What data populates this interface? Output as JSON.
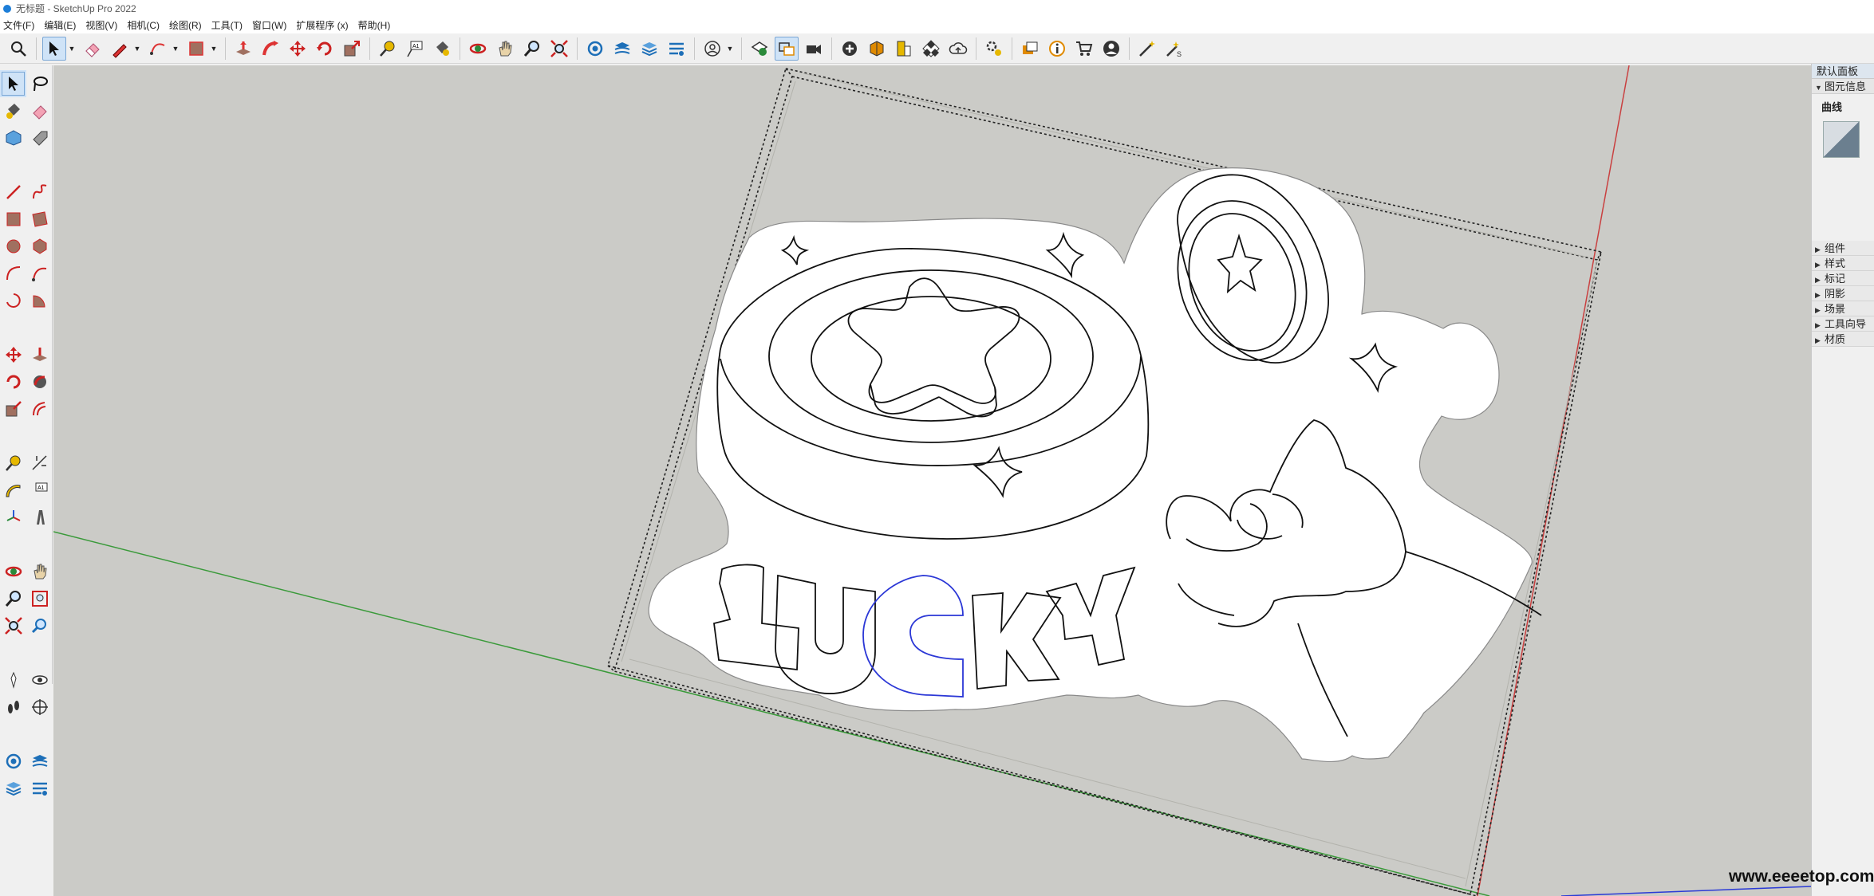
{
  "window": {
    "title": "无标题 - SketchUp Pro 2022"
  },
  "menu": [
    "文件(F)",
    "编辑(E)",
    "视图(V)",
    "相机(C)",
    "绘图(R)",
    "工具(T)",
    "窗口(W)",
    "扩展程序 (x)",
    "帮助(H)"
  ],
  "toolbar_icons": [
    "search-icon",
    "select-icon",
    "eraser-icon",
    "pencil-icon",
    "arc-icon",
    "rectangle-icon",
    "push-pull-icon",
    "follow-me-icon",
    "move-icon",
    "rotate-icon",
    "scale-icon",
    "tape-measure-icon",
    "text-icon",
    "paint-bucket-icon",
    "orbit-icon",
    "pan-icon",
    "zoom-icon",
    "zoom-extents-icon",
    "3d-warehouse-icon",
    "layers-icon",
    "user-icon",
    "geo-location-icon",
    "scene-icon",
    "camera-icon",
    "add-icon",
    "component-icon",
    "sandbox-icon",
    "cloud-icon",
    "extension-icon",
    "message-icon",
    "info-icon",
    "cart-icon",
    "account-icon",
    "magic-wand-icon"
  ],
  "tray": {
    "title": "默认面板",
    "entity_info_header": "图元信息",
    "entity_type": "曲线",
    "panels": [
      "组件",
      "样式",
      "标记",
      "阴影",
      "场景",
      "工具向导",
      "材质"
    ]
  },
  "scene": {
    "word": "LUCKY",
    "letters": [
      "L",
      "U",
      "C",
      "K",
      "Y"
    ],
    "selected_letter": "C",
    "selection_color": "#2b37d6",
    "outline_color": "#111111",
    "background_color": "#cbcbc7",
    "green_axis_color": "#3a9a3a",
    "red_axis_color": "#c94040"
  },
  "watermark": "www.eeeetop.com"
}
